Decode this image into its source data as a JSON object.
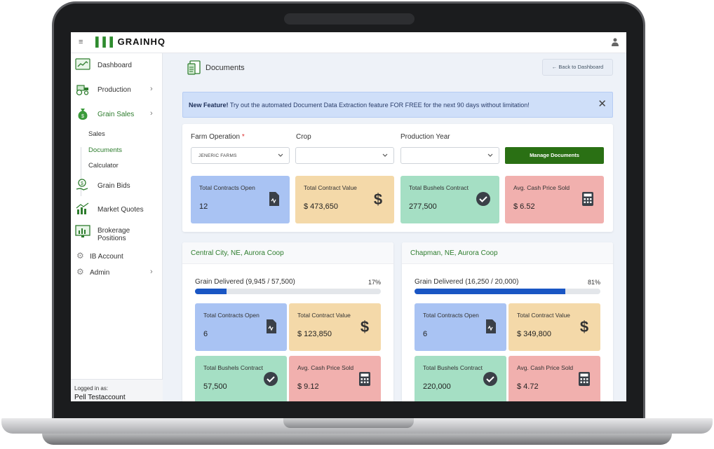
{
  "app": {
    "brand": "GRAINHQ",
    "brand_color": "#2e8b2e"
  },
  "sidebar": {
    "items": [
      {
        "label": "Dashboard",
        "icon": "dashboard-chart-icon"
      },
      {
        "label": "Production",
        "icon": "tractor-icon"
      },
      {
        "label": "Grain Sales",
        "icon": "money-bag-icon"
      },
      {
        "label": "Grain Bids",
        "icon": "hand-coin-icon"
      },
      {
        "label": "Market Quotes",
        "icon": "market-chart-icon"
      },
      {
        "label": "Brokerage Positions",
        "icon": "monitor-chart-icon"
      },
      {
        "label": "IB Account",
        "icon": "gear-icon"
      },
      {
        "label": "Admin",
        "icon": "gear-icon"
      }
    ],
    "grain_sales_sub": [
      "Sales",
      "Documents",
      "Calculator"
    ],
    "login_label": "Logged in as:",
    "login_user": "Pell Testaccount"
  },
  "page": {
    "title": "Documents",
    "back_label": "Back to Dashboard"
  },
  "alert": {
    "title": "New Feature!",
    "message": "Try out the automated Document Data Extraction feature FOR FREE for the next 90 days without limitation!"
  },
  "filters": {
    "farm_label": "Farm Operation",
    "farm_required": "*",
    "farm_value": "JENERIC FARMS",
    "crop_label": "Crop",
    "crop_value": "",
    "year_label": "Production Year",
    "year_value": "",
    "manage_label": "Manage Documents"
  },
  "summary": [
    {
      "label": "Total Contracts Open",
      "value": "12",
      "icon": "document-icon",
      "color": "#a9c3f3"
    },
    {
      "label": "Total Contract Value",
      "value": "$ 473,650",
      "icon": "dollar-icon",
      "color": "#f4d9a9"
    },
    {
      "label": "Total Bushels Contract",
      "value": "277,500",
      "icon": "check-circle-icon",
      "color": "#a5dfc4"
    },
    {
      "label": "Avg. Cash Price Sold",
      "value": "$ 6.52",
      "icon": "calculator-icon",
      "color": "#f1b0ae"
    }
  ],
  "locations": [
    {
      "name": "Central City, NE, Aurora Coop",
      "progress_label": "Grain Delivered (9,945 / 57,500)",
      "progress_pct": "17%",
      "progress": 0.17,
      "cards": [
        {
          "label": "Total Contracts Open",
          "value": "6"
        },
        {
          "label": "Total Contract Value",
          "value": "$ 123,850"
        },
        {
          "label": "Total Bushels Contract",
          "value": "57,500"
        },
        {
          "label": "Avg. Cash Price Sold",
          "value": "$ 9.12"
        }
      ]
    },
    {
      "name": "Chapman, NE, Aurora Coop",
      "progress_label": "Grain Delivered (16,250 / 20,000)",
      "progress_pct": "81%",
      "progress": 0.81,
      "cards": [
        {
          "label": "Total Contracts Open",
          "value": "6"
        },
        {
          "label": "Total Contract Value",
          "value": "$ 349,800"
        },
        {
          "label": "Total Bushels Contract",
          "value": "220,000"
        },
        {
          "label": "Avg. Cash Price Sold",
          "value": "$ 4.72"
        }
      ]
    }
  ],
  "colors": {
    "accent_green": "#2e7d2e",
    "button_green": "#2a7014",
    "progress_blue": "#1a56c4"
  }
}
